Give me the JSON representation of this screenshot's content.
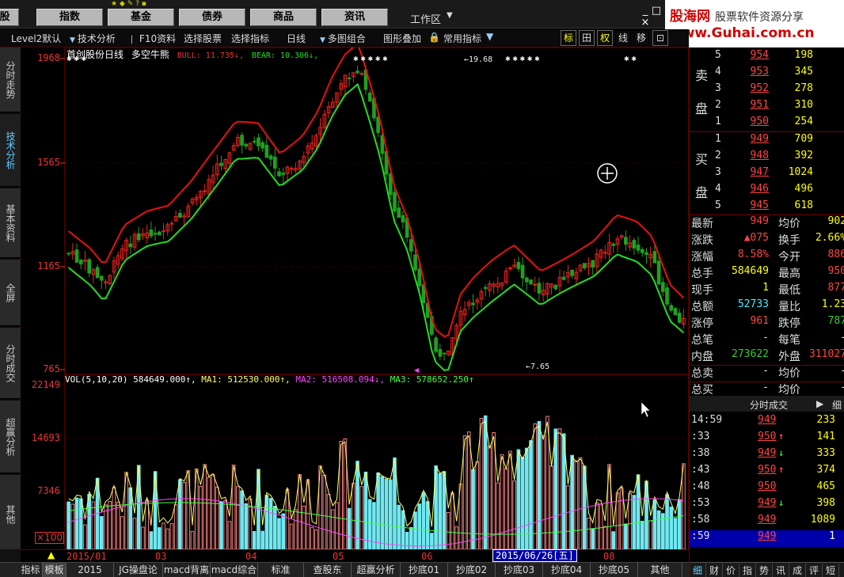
{
  "top_menu": {
    "items": [
      "股",
      "指数",
      "基金",
      "债券",
      "商品",
      "资讯"
    ],
    "workspace": "工作区",
    "mini_icons": "★ ◆ ✎ ? ▪",
    "controls": [
      "_",
      "□",
      "×"
    ]
  },
  "logo": {
    "brand": "股海网",
    "slogan": "股票软件资源分享",
    "url": "www.Guhai.com.cn"
  },
  "toolbar": {
    "level2": "Level2默认",
    "tech": "技术分析",
    "f10": "F10资料",
    "pick_stock": "选择股票",
    "pick_indicator": "选择指标",
    "period": "日线",
    "multi": "多图组合",
    "overlay": "图形叠加",
    "lock": "🔒",
    "common_ind": "常用指标",
    "btn_mark": "标",
    "btn_cross": "田",
    "btn_right": "权",
    "btn_line": "线",
    "btn_move": "移",
    "btn_last": "⊡"
  },
  "left_tabs": [
    "分时走势",
    "技术分析",
    "基本资料",
    "全屏",
    "分时成交",
    "超赢分析",
    "其他"
  ],
  "kline": {
    "stock_name": "首创股份日线",
    "indicator_name": "多空牛熊",
    "bull_text": "BULL: 11.735↓,",
    "bear_text": "BEAR: 10.306↓,",
    "y_labels": [
      "1968",
      "1565",
      "1165",
      "765"
    ],
    "high_annot": "←19.68",
    "low_annot": "←7.65"
  },
  "volume": {
    "vol_text": "VOL(5,10,20) 584649.000↑,",
    "ma1_text": "MA1: 512530.000↑,",
    "ma2_text": "MA2: 516508.094↓,",
    "ma3_text": "MA3: 578652.250↑",
    "y_labels": [
      "22149",
      "14693",
      "7346"
    ],
    "unit": "×100"
  },
  "date_bar": {
    "period": "日线",
    "labels": [
      "2015/01",
      "03",
      "04",
      "05",
      "06",
      "08"
    ],
    "cursor_date": "2015/06/26[五]"
  },
  "bottom_tabs": [
    "指标",
    "模板",
    "2015",
    "JG操盘论",
    "macd背离",
    "macd综合",
    "标准",
    "查股东",
    "超赢分析",
    "抄底01",
    "抄底02",
    "抄底03",
    "抄底04",
    "抄底05",
    "其他",
    "\b"
  ],
  "order_book": {
    "sell_label": [
      "卖",
      "盘"
    ],
    "buy_label": [
      "买",
      "盘"
    ],
    "sell": [
      {
        "level": "5",
        "price": "954",
        "volume": "198"
      },
      {
        "level": "4",
        "price": "953",
        "volume": "345"
      },
      {
        "level": "3",
        "price": "952",
        "volume": "278"
      },
      {
        "level": "2",
        "price": "951",
        "volume": "310"
      },
      {
        "level": "1",
        "price": "950",
        "volume": "254"
      }
    ],
    "buy": [
      {
        "level": "1",
        "price": "949",
        "volume": "709"
      },
      {
        "level": "2",
        "price": "948",
        "volume": "392"
      },
      {
        "level": "3",
        "price": "947",
        "volume": "1024"
      },
      {
        "level": "4",
        "price": "946",
        "volume": "496"
      },
      {
        "level": "5",
        "price": "945",
        "volume": "618"
      }
    ]
  },
  "stats": [
    {
      "k1": "最新",
      "v1": "949",
      "c1": "red",
      "k2": "均价",
      "v2": "902",
      "c2": "yel"
    },
    {
      "k1": "涨跌",
      "v1": "▲075",
      "c1": "red",
      "k2": "换手",
      "v2": "2.66%",
      "c2": "yel"
    },
    {
      "k1": "涨幅",
      "v1": "8.58%",
      "c1": "red",
      "k2": "今开",
      "v2": "886",
      "c2": "red"
    },
    {
      "k1": "总手",
      "v1": "584649",
      "c1": "yel",
      "k2": "最高",
      "v2": "950",
      "c2": "red"
    },
    {
      "k1": "现手",
      "v1": "1",
      "c1": "yel",
      "k2": "最低",
      "v2": "877",
      "c2": "red"
    },
    {
      "k1": "总额",
      "v1": "52733",
      "c1": "cyan",
      "k2": "量比",
      "v2": "1.23",
      "c2": "yel"
    },
    {
      "k1": "涨停",
      "v1": "961",
      "c1": "red",
      "k2": "跌停",
      "v2": "787",
      "c2": "grn"
    },
    {
      "k1": "总笔",
      "v1": "-",
      "c1": "wht",
      "k2": "每笔",
      "v2": "-",
      "c2": "wht"
    },
    {
      "k1": "内盘",
      "v1": "273622",
      "c1": "grn",
      "k2": "外盘",
      "v2": "311027",
      "c2": "red"
    },
    {
      "k1": "总卖",
      "v1": "-",
      "c1": "wht",
      "k2": "均价",
      "v2": "-",
      "c2": "wht"
    },
    {
      "k1": "总买",
      "v1": "-",
      "c1": "wht",
      "k2": "均价",
      "v2": "-",
      "c2": "wht"
    }
  ],
  "ticks_header": {
    "title": "分时成交",
    "arrow": "▶",
    "detail": "细"
  },
  "ticks": [
    {
      "time": "14:59",
      "price": "949",
      "arrow": "",
      "volume": "233"
    },
    {
      "time": ":33",
      "price": "950",
      "arrow": "up",
      "volume": "141"
    },
    {
      "time": ":38",
      "price": "949",
      "arrow": "down",
      "volume": "333"
    },
    {
      "time": ":43",
      "price": "950",
      "arrow": "up",
      "volume": "374"
    },
    {
      "time": ":48",
      "price": "950",
      "arrow": "",
      "volume": "465"
    },
    {
      "time": ":53",
      "price": "949",
      "arrow": "down",
      "volume": "398"
    },
    {
      "time": ":58",
      "price": "949",
      "arrow": "",
      "volume": "1089"
    },
    {
      "time": ":59",
      "price": "949",
      "arrow": "",
      "volume": "1"
    }
  ],
  "right_tabs": [
    "细",
    "财",
    "价",
    "指",
    "势",
    "讯",
    "成",
    "评",
    "短"
  ],
  "colors": {
    "bull_line": "#e81010",
    "bear_line": "#22dd22",
    "up_candle": "#ee2222",
    "down_candle": "#20a020",
    "vol_up": "#f08080",
    "vol_down": "#70e8f0",
    "ma1": "#ffff66",
    "ma2": "#ff44ff",
    "ma3": "#44ff44"
  }
}
